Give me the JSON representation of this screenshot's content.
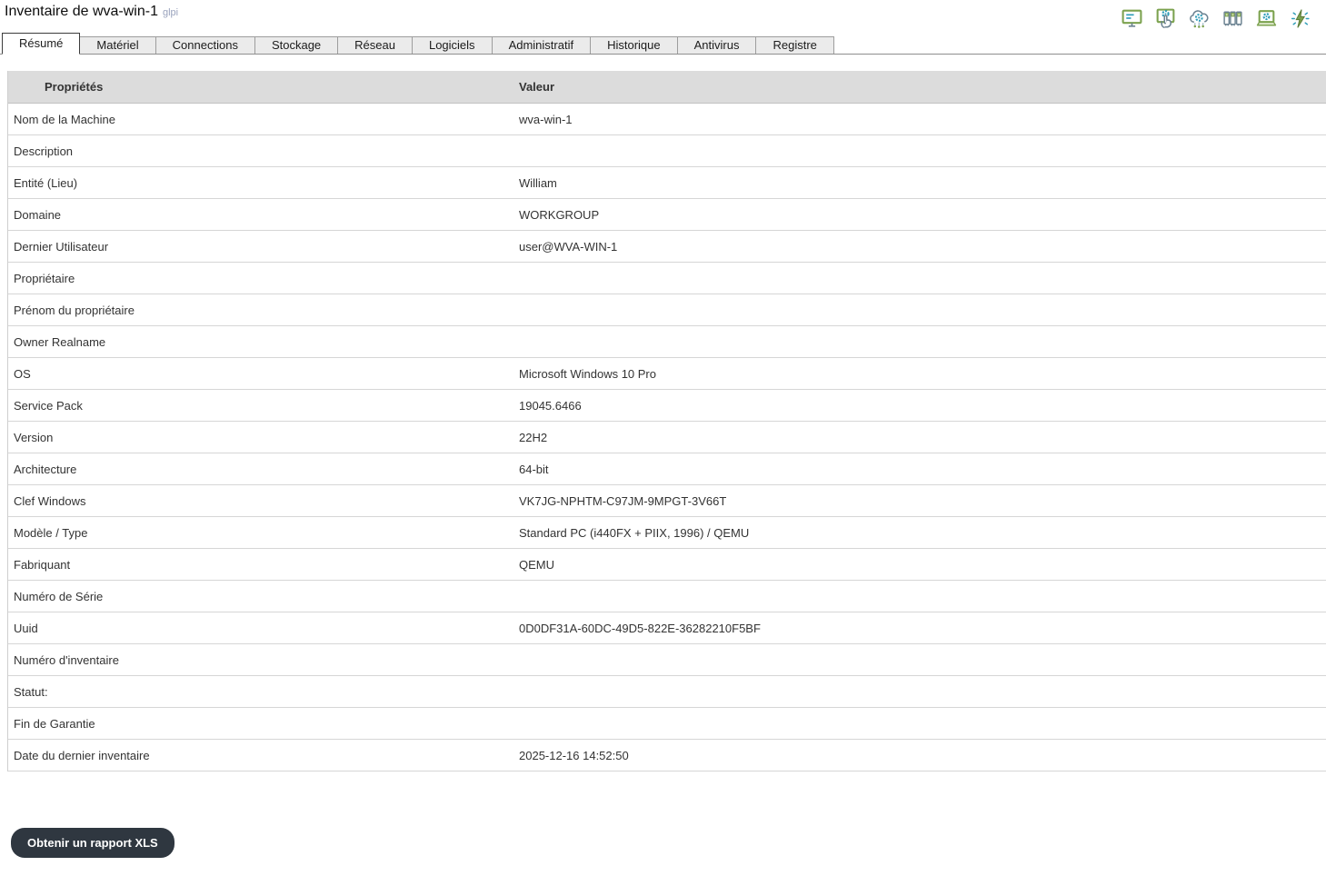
{
  "header": {
    "title": "Inventaire de wva-win-1",
    "brand": "glpi"
  },
  "toolbar": {
    "icons": [
      {
        "name": "display-summary-icon"
      },
      {
        "name": "remote-touch-config-icon"
      },
      {
        "name": "snmp-cloud-icon"
      },
      {
        "name": "server-rack-icon"
      },
      {
        "name": "laptop-settings-icon"
      },
      {
        "name": "wake-on-lan-icon"
      }
    ]
  },
  "tabs": [
    {
      "label": "Résumé",
      "active": true
    },
    {
      "label": "Matériel",
      "active": false
    },
    {
      "label": "Connections",
      "active": false
    },
    {
      "label": "Stockage",
      "active": false
    },
    {
      "label": "Réseau",
      "active": false
    },
    {
      "label": "Logiciels",
      "active": false
    },
    {
      "label": "Administratif",
      "active": false
    },
    {
      "label": "Historique",
      "active": false
    },
    {
      "label": "Antivirus",
      "active": false
    },
    {
      "label": "Registre",
      "active": false
    }
  ],
  "table": {
    "headers": {
      "property": "Propriétés",
      "value": "Valeur"
    },
    "rows": [
      {
        "label": "Nom de la Machine",
        "value": "wva-win-1"
      },
      {
        "label": "Description",
        "value": ""
      },
      {
        "label": "Entité (Lieu)",
        "value": "William"
      },
      {
        "label": "Domaine",
        "value": "WORKGROUP"
      },
      {
        "label": "Dernier Utilisateur",
        "value": "user@WVA-WIN-1"
      },
      {
        "label": "Propriétaire",
        "value": ""
      },
      {
        "label": "Prénom du propriétaire",
        "value": ""
      },
      {
        "label": "Owner Realname",
        "value": ""
      },
      {
        "label": "OS",
        "value": "Microsoft Windows 10 Pro"
      },
      {
        "label": "Service Pack",
        "value": "19045.6466"
      },
      {
        "label": "Version",
        "value": "22H2"
      },
      {
        "label": "Architecture",
        "value": "64-bit"
      },
      {
        "label": "Clef Windows",
        "value": "VK7JG-NPHTM-C97JM-9MPGT-3V66T"
      },
      {
        "label": "Modèle / Type",
        "value": "Standard PC (i440FX + PIIX, 1996) / QEMU"
      },
      {
        "label": "Fabriquant",
        "value": "QEMU"
      },
      {
        "label": "Numéro de Série",
        "value": ""
      },
      {
        "label": "Uuid",
        "value": "0D0DF31A-60DC-49D5-822E-36282210F5BF"
      },
      {
        "label": "Numéro d'inventaire",
        "value": ""
      },
      {
        "label": "Statut:",
        "value": ""
      },
      {
        "label": "Fin de Garantie",
        "value": ""
      },
      {
        "label": "Date du dernier inventaire",
        "value": "2025-12-16 14:52:50"
      }
    ]
  },
  "footer": {
    "xls_button": "Obtenir un rapport XLS"
  },
  "colors": {
    "accent_green": "#7ca24f",
    "accent_teal": "#2e9cb8",
    "icon_outline": "#6b8291",
    "header_bg": "#dcdcdc",
    "button_bg": "#2f3740",
    "brand_text": "#9aa3bd"
  }
}
